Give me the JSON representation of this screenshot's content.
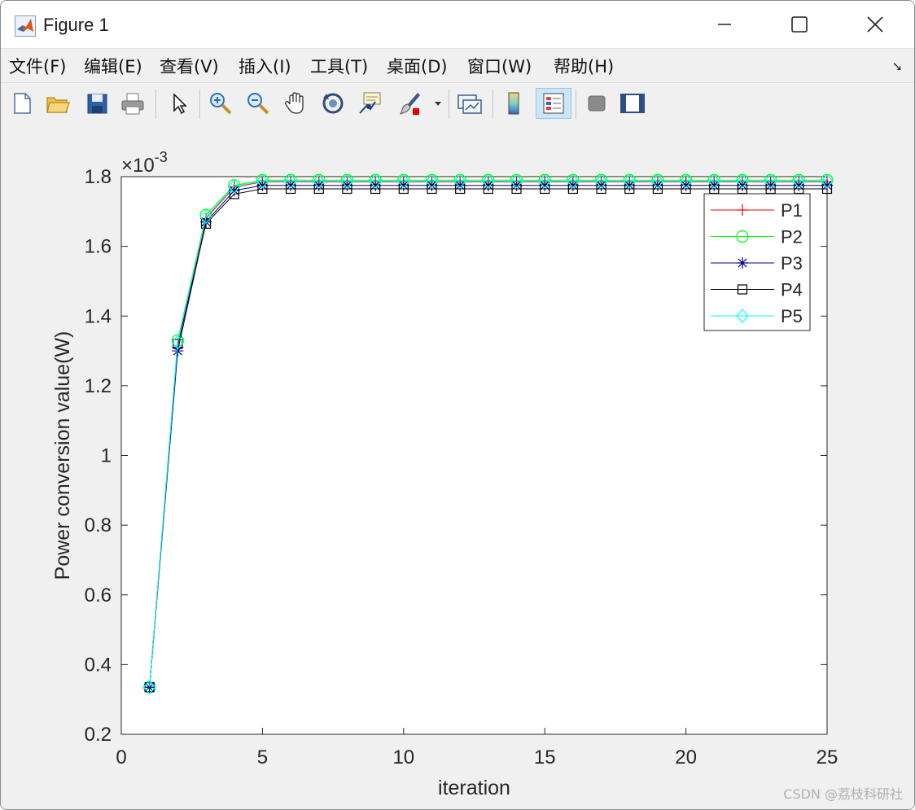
{
  "window": {
    "title": "Figure 1"
  },
  "menu": {
    "items": [
      "文件(F)",
      "编辑(E)",
      "查看(V)",
      "插入(I)",
      "工具(T)",
      "桌面(D)",
      "窗口(W)",
      "帮助(H)"
    ]
  },
  "toolbar": {
    "icons": [
      "new-figure-icon",
      "open-file-icon",
      "save-icon",
      "print-icon",
      "pointer-icon",
      "zoom-in-icon",
      "zoom-out-icon",
      "pan-icon",
      "rotate-icon",
      "data-cursor-icon",
      "brush-icon",
      "link-plot-icon",
      "colorbar-icon",
      "legend-icon",
      "hide-plot-tools-icon",
      "show-plot-tools-icon"
    ]
  },
  "watermark": "CSDN @荔枝科研社",
  "chart_data": {
    "type": "line",
    "xlabel": "iteration",
    "ylabel": "Power conversion value(W)",
    "exponent_label": "×10",
    "exponent_power": "-3",
    "xlim": [
      0,
      25
    ],
    "ylim": [
      0.2,
      1.8
    ],
    "xticks": [
      "0",
      "5",
      "10",
      "15",
      "20",
      "25"
    ],
    "yticks": [
      "0.2",
      "0.4",
      "0.6",
      "0.8",
      "1",
      "1.2",
      "1.4",
      "1.6",
      "1.8"
    ],
    "legend_position": "top-right",
    "grid": false,
    "x": [
      1,
      2,
      3,
      4,
      5,
      6,
      7,
      8,
      9,
      10,
      11,
      12,
      13,
      14,
      15,
      16,
      17,
      18,
      19,
      20,
      21,
      22,
      23,
      24,
      25
    ],
    "series": [
      {
        "name": "P1",
        "color": "#ff0000",
        "marker": "plus",
        "values": [
          0.335,
          1.31,
          1.68,
          1.77,
          1.785,
          1.785,
          1.785,
          1.785,
          1.785,
          1.785,
          1.785,
          1.785,
          1.785,
          1.785,
          1.785,
          1.785,
          1.785,
          1.785,
          1.785,
          1.785,
          1.785,
          1.785,
          1.785,
          1.785,
          1.785
        ]
      },
      {
        "name": "P2",
        "color": "#00ff00",
        "marker": "circle",
        "values": [
          0.335,
          1.33,
          1.69,
          1.775,
          1.79,
          1.79,
          1.79,
          1.79,
          1.79,
          1.79,
          1.79,
          1.79,
          1.79,
          1.79,
          1.79,
          1.79,
          1.79,
          1.79,
          1.79,
          1.79,
          1.79,
          1.79,
          1.79,
          1.79,
          1.79
        ]
      },
      {
        "name": "P3",
        "color": "#00008b",
        "marker": "star",
        "values": [
          0.335,
          1.3,
          1.67,
          1.76,
          1.775,
          1.775,
          1.775,
          1.775,
          1.775,
          1.775,
          1.775,
          1.775,
          1.775,
          1.775,
          1.775,
          1.775,
          1.775,
          1.775,
          1.775,
          1.775,
          1.775,
          1.775,
          1.775,
          1.775,
          1.775
        ]
      },
      {
        "name": "P4",
        "color": "#000000",
        "marker": "square",
        "values": [
          0.335,
          1.32,
          1.665,
          1.75,
          1.765,
          1.765,
          1.765,
          1.765,
          1.765,
          1.765,
          1.765,
          1.765,
          1.765,
          1.765,
          1.765,
          1.765,
          1.765,
          1.765,
          1.765,
          1.765,
          1.765,
          1.765,
          1.765,
          1.765,
          1.765
        ]
      },
      {
        "name": "P5",
        "color": "#00ffff",
        "marker": "diamond",
        "values": [
          0.335,
          1.325,
          1.685,
          1.772,
          1.787,
          1.787,
          1.787,
          1.787,
          1.787,
          1.787,
          1.787,
          1.787,
          1.787,
          1.787,
          1.787,
          1.787,
          1.787,
          1.787,
          1.787,
          1.787,
          1.787,
          1.787,
          1.787,
          1.787,
          1.787
        ]
      }
    ]
  }
}
